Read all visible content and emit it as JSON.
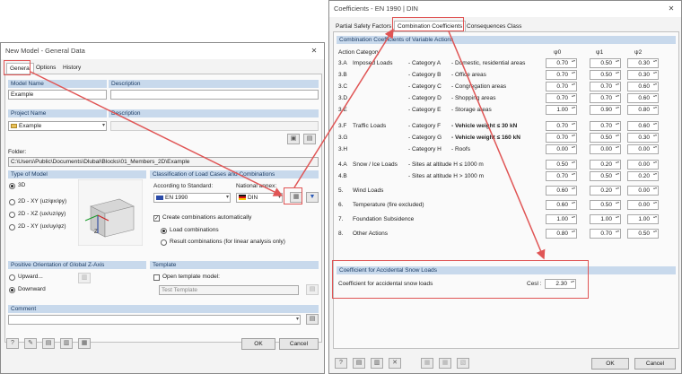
{
  "left": {
    "title": "New Model - General Data",
    "tabs": [
      "General",
      "Options",
      "History"
    ],
    "general": {
      "model_name_label": "Model Name",
      "model_name_value": "Example",
      "description_label": "Description",
      "project_name_label": "Project Name",
      "project_value": "Example",
      "project_description_label": "Description",
      "folder_label": "Folder:",
      "folder_value": "C:\\Users\\Public\\Documents\\Dlubal\\Blocks\\01_Members_2D\\Example"
    },
    "type_of_model": {
      "header": "Type of Model",
      "options": [
        "3D",
        "2D - XY (uz/φx/φy)",
        "2D - XZ (ux/uz/φy)",
        "2D - XY (ux/uy/φz)"
      ],
      "selected": 0
    },
    "classification": {
      "header": "Classification of Load Cases and Combinations",
      "standard_label": "According to Standard:",
      "standard_value": "EN 1990",
      "annex_label": "National annex:",
      "annex_value": "DIN",
      "create_combinations_label": "Create combinations automatically",
      "load_combinations_label": "Load combinations",
      "result_combinations_label": "Result combinations (for linear analysis only)"
    },
    "z_axis": {
      "header": "Positive Orientation of Global Z-Axis",
      "upward": "Upward...",
      "downward": "Downward"
    },
    "template": {
      "header": "Template",
      "open_label": "Open template model:",
      "value": "Test Template"
    },
    "comment": {
      "header": "Comment"
    },
    "ok": "OK",
    "cancel": "Cancel"
  },
  "right": {
    "title": "Coefficients - EN 1990 | DIN",
    "tabs": [
      "Partial Safety Factors",
      "Combination Coefficients",
      "Consequences Class"
    ],
    "section_header": "Combination Coefficients of Variable Actions",
    "col_action": "Action Category",
    "col_psi0": "ψ0",
    "col_psi1": "ψ1",
    "col_psi2": "ψ2",
    "rows": [
      {
        "id": "3.A",
        "group": "Imposed Loads",
        "cat": "- Category A",
        "desc": "- Domestic, residential areas",
        "v": [
          "0.70",
          "0.50",
          "0.30"
        ]
      },
      {
        "id": "3.B",
        "group": "",
        "cat": "- Category B",
        "desc": "- Office areas",
        "v": [
          "0.70",
          "0.50",
          "0.30"
        ]
      },
      {
        "id": "3.C",
        "group": "",
        "cat": "- Category C",
        "desc": "- Congregation areas",
        "v": [
          "0.70",
          "0.70",
          "0.60"
        ]
      },
      {
        "id": "3.D",
        "group": "",
        "cat": "- Category D",
        "desc": "- Shopping areas",
        "v": [
          "0.70",
          "0.70",
          "0.60"
        ]
      },
      {
        "id": "3.E",
        "group": "",
        "cat": "- Category E",
        "desc": "- Storage areas",
        "v": [
          "1.00",
          "0.90",
          "0.80"
        ]
      },
      {
        "id": "3.F",
        "group": "Traffic Loads",
        "cat": "- Category F",
        "desc": "- Vehicle weight ≤ 30 kN",
        "v": [
          "0.70",
          "0.70",
          "0.60"
        ]
      },
      {
        "id": "3.G",
        "group": "",
        "cat": "- Category G",
        "desc": "- Vehicle weight ≤ 160 kN",
        "v": [
          "0.70",
          "0.50",
          "0.30"
        ]
      },
      {
        "id": "3.H",
        "group": "",
        "cat": "- Category H",
        "desc": "- Roofs",
        "v": [
          "0.00",
          "0.00",
          "0.00"
        ]
      },
      {
        "id": "4.A",
        "group": "Snow / Ice Loads",
        "cat": "- Sites at altitude H ≤ 1000 m",
        "desc": "",
        "v": [
          "0.50",
          "0.20",
          "0.00"
        ]
      },
      {
        "id": "4.B",
        "group": "",
        "cat": "- Sites at altitude H > 1000 m",
        "desc": "",
        "v": [
          "0.70",
          "0.50",
          "0.20"
        ]
      },
      {
        "id": "5.",
        "group": "Wind Loads",
        "cat": "",
        "desc": "",
        "v": [
          "0.60",
          "0.20",
          "0.00"
        ]
      },
      {
        "id": "6.",
        "group": "Temperature (fire excluded)",
        "cat": "",
        "desc": "",
        "v": [
          "0.60",
          "0.50",
          "0.00"
        ]
      },
      {
        "id": "7.",
        "group": "Foundation Subsidence",
        "cat": "",
        "desc": "",
        "v": [
          "1.00",
          "1.00",
          "1.00"
        ]
      },
      {
        "id": "8.",
        "group": "Other Actions",
        "cat": "",
        "desc": "",
        "v": [
          "0.80",
          "0.70",
          "0.50"
        ]
      }
    ],
    "snow": {
      "header": "Coefficient for Accidental Snow Loads",
      "label": "Coefficient for accidental snow loads",
      "symbol": "Cesl :",
      "value": "2.30"
    },
    "ok": "OK",
    "cancel": "Cancel"
  }
}
